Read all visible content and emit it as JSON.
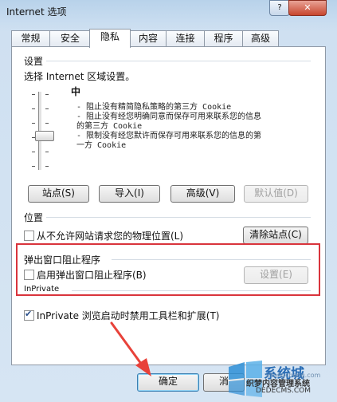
{
  "window": {
    "title": "Internet 选项",
    "help_glyph": "?",
    "close_glyph": "✕"
  },
  "tabs": [
    "常规",
    "安全",
    "隐私",
    "内容",
    "连接",
    "程序",
    "高级"
  ],
  "settings": {
    "group_label": "设置",
    "zone_prompt": "选择 Internet 区域设置。",
    "level": "中",
    "desc_lines": [
      "- 阻止没有精简隐私策略的第三方 Cookie",
      "- 阻止没有经您明确同意而保存可用来联系您的信息",
      "的第三方 Cookie",
      "- 限制没有经您默许而保存可用来联系您的信息的第",
      "一方 Cookie"
    ],
    "buttons": {
      "sites": "站点(S)",
      "import": "导入(I)",
      "advanced": "高级(V)",
      "default": "默认值(D)"
    }
  },
  "location": {
    "group_label": "位置",
    "never_allow_label": "从不允许网站请求您的物理位置(L)",
    "clear_sites": "清除站点(C)"
  },
  "popup": {
    "group_label": "弹出窗口阻止程序",
    "enable_label": "启用弹出窗口阻止程序(B)",
    "settings_button": "设置(E)"
  },
  "inprivate": {
    "group_label": "InPrivate",
    "disable_toolbars_label": "InPrivate 浏览启动时禁用工具栏和扩展(T)"
  },
  "footer": {
    "ok": "确定",
    "cancel": "消"
  },
  "watermark": {
    "line1": "系统城",
    "line2": "织梦内容管理系统",
    "line3": "DEDECMS.COM",
    "url": "xitongcheng.com"
  },
  "colors": {
    "highlight": "#d9343c",
    "arrow": "#e8423a",
    "panel_bg": "#ffffff"
  }
}
